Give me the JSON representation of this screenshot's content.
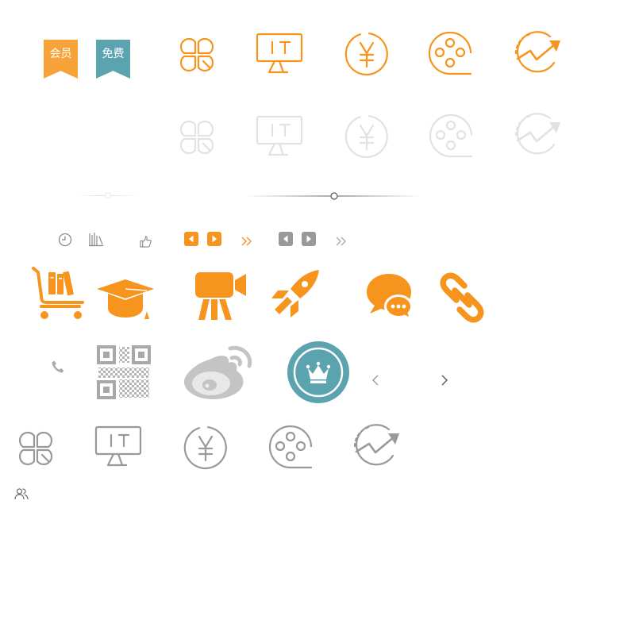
{
  "colors": {
    "orange": "#f7941d",
    "teal": "#5ba3ae",
    "gray": "#999999",
    "light_gray": "#e2e2e2",
    "dark_gray": "#666666"
  },
  "badges": {
    "member": "会员",
    "free": "免费"
  },
  "category_icons": [
    "clover-icon",
    "it-monitor-icon",
    "yuan-coin-icon",
    "film-reel-icon",
    "growth-chart-icon"
  ],
  "small_icons": [
    "clock-icon",
    "bookshelf-icon",
    "thumbs-up-icon",
    "arrow-left-icon",
    "arrow-right-icon",
    "double-chevron-right-icon"
  ],
  "feature_icons": [
    "book-cart-icon",
    "graduation-cap-icon",
    "video-camera-icon",
    "rocket-icon",
    "chat-bubbles-icon",
    "link-icon"
  ],
  "social_icons": [
    "phone-icon",
    "qr-code-icon",
    "weibo-icon",
    "crown-icon",
    "chevron-left-icon",
    "chevron-right-icon"
  ],
  "misc_icons": [
    "users-icon"
  ]
}
